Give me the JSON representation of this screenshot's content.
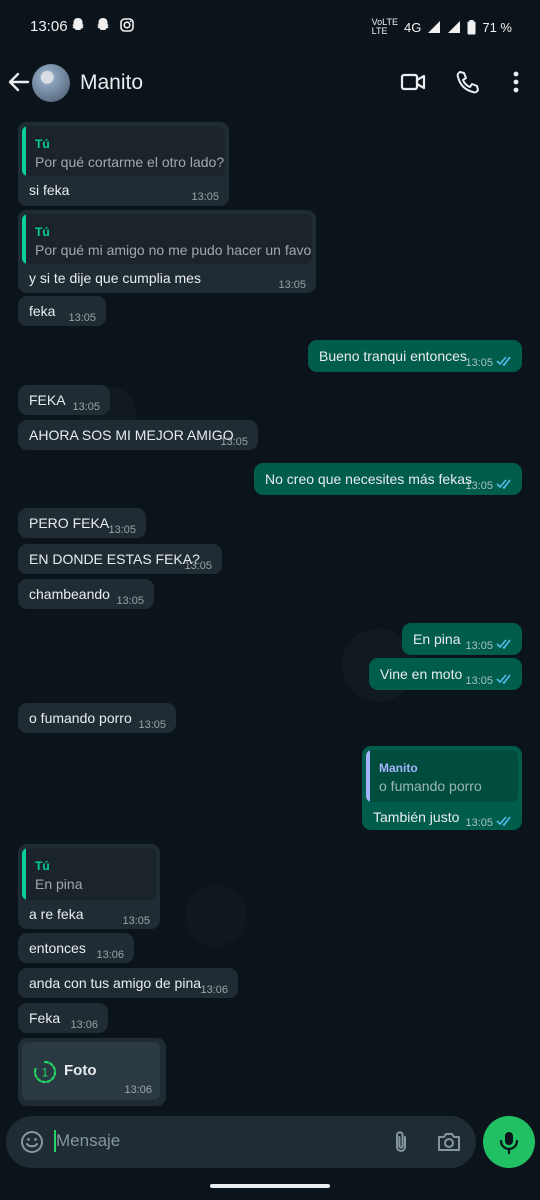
{
  "status_bar": {
    "time": "13:06",
    "network_lte_top": "VoLTE",
    "network_lte_bottom": "LTE",
    "network": "4G",
    "battery": "71 %"
  },
  "header": {
    "contact_name": "Manito",
    "icons": [
      "back-arrow-icon",
      "video-call-icon",
      "voice-call-icon",
      "more-options-icon"
    ]
  },
  "messages": [
    {
      "dir": "in",
      "quote_author": "Tú",
      "quote_text": "Por qué cortarme el otro lado?",
      "text": "si feka",
      "time": "13:05"
    },
    {
      "dir": "in",
      "quote_author": "Tú",
      "quote_text": "Por qué mi amigo no me pudo hacer un favor",
      "text": "y si te dije que cumplia mes",
      "time": "13:05"
    },
    {
      "dir": "in",
      "text": "feka",
      "time": "13:05"
    },
    {
      "dir": "out",
      "text": "Bueno tranqui entonces",
      "time": "13:05"
    },
    {
      "dir": "in",
      "text": "FEKA",
      "time": "13:05"
    },
    {
      "dir": "in",
      "text": "AHORA SOS MI MEJOR AMIGO",
      "time": "13:05"
    },
    {
      "dir": "out",
      "text": "No creo que necesites más fekas",
      "time": "13:05"
    },
    {
      "dir": "in",
      "text": "PERO FEKA",
      "time": "13:05"
    },
    {
      "dir": "in",
      "text": "EN DONDE ESTAS FEKA?",
      "time": "13:05"
    },
    {
      "dir": "in",
      "text": "chambeando",
      "time": "13:05"
    },
    {
      "dir": "out",
      "text": "En pina",
      "time": "13:05"
    },
    {
      "dir": "out",
      "text": "Vine en moto",
      "time": "13:05"
    },
    {
      "dir": "in",
      "text": "o fumando porro",
      "time": "13:05"
    },
    {
      "dir": "out",
      "quote_author": "Manito",
      "quote_text": "o fumando porro",
      "text": "También justo",
      "time": "13:05"
    },
    {
      "dir": "in",
      "quote_author": "Tú",
      "quote_text": "En pina",
      "text": "a re feka",
      "time": "13:05"
    },
    {
      "dir": "in",
      "text": "entonces",
      "time": "13:06"
    },
    {
      "dir": "in",
      "text": "anda con tus amigo de pina",
      "time": "13:06"
    },
    {
      "dir": "in",
      "text": "Feka",
      "time": "13:06"
    },
    {
      "dir": "in",
      "type": "view-once-photo",
      "text": "Foto",
      "time": "13:06",
      "view_once_badge": "1"
    }
  ],
  "composer": {
    "placeholder": "Mensaje",
    "icons": [
      "emoji-icon",
      "attach-icon",
      "camera-icon",
      "mic-icon"
    ]
  },
  "colors": {
    "background": "#0b141a",
    "incoming_bubble": "#202c33",
    "outgoing_bubble": "#005c4b",
    "quote_you_bar": "#06cf9c",
    "quote_contact_bar": "#a5b3ff",
    "read_ticks": "#53bdeb",
    "accent": "#21c063"
  }
}
